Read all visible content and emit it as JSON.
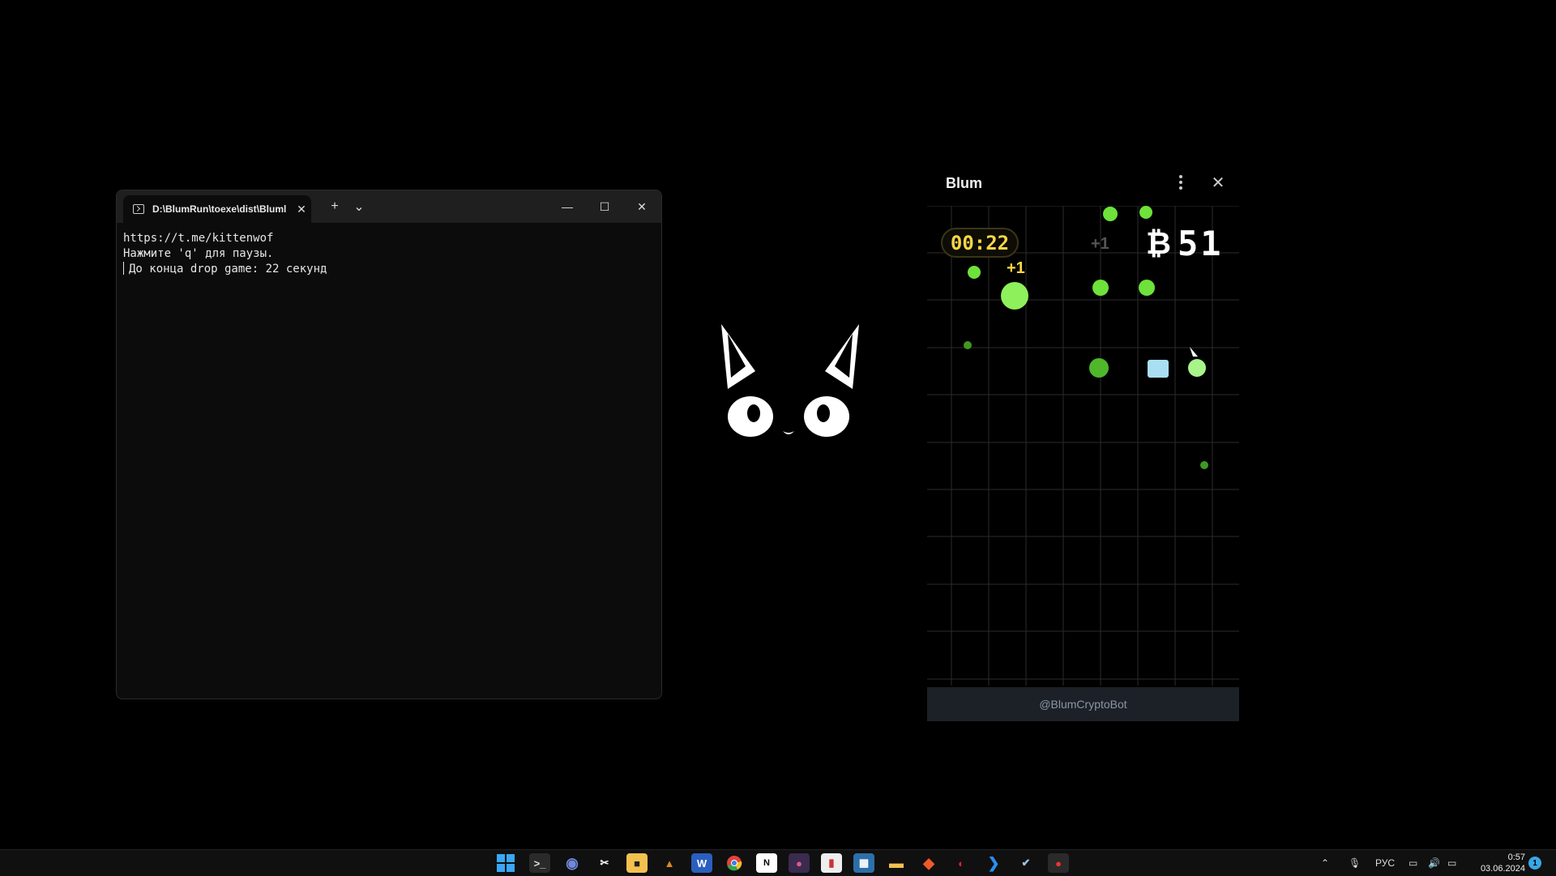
{
  "terminal": {
    "tab_title": "D:\\BlumRun\\toexe\\dist\\Bluml",
    "tab_close": "✕",
    "new_tab": "+",
    "dropdown": "⌄",
    "minimize": "—",
    "maximize": "☐",
    "close": "✕",
    "lines": [
      "https://t.me/kittenwof",
      "",
      "Нажмите 'q' для паузы.",
      "До конца drop game: 22 секунд"
    ]
  },
  "blum": {
    "title": "Blum",
    "close": "✕",
    "timer": "00:22",
    "score_symbol": "₿",
    "score": "51",
    "float_plus_1": "+1",
    "float_plus_2": "+1",
    "footer": "@BlumCryptoBot"
  },
  "taskbar": {
    "icons": [
      "windows-start-icon",
      "terminal-icon",
      "discord-icon",
      "capcut-icon",
      "store-icon",
      "winrar-icon",
      "word-icon",
      "chrome-icon",
      "overlay-app-icon",
      "notion-icon",
      "unknown-app-icon",
      "calculator-icon",
      "file-explorer-icon",
      "brave-icon",
      "ghidra-icon",
      "vscode-icon",
      "steam-icon",
      "media-app-icon"
    ],
    "language": "РУС",
    "time": "0:57",
    "date": "03.06.2024",
    "notification_count": "1"
  },
  "colors": {
    "accent_green": "#6ee13a",
    "timer_yellow": "#f7d548",
    "taskbar": "#101010"
  }
}
